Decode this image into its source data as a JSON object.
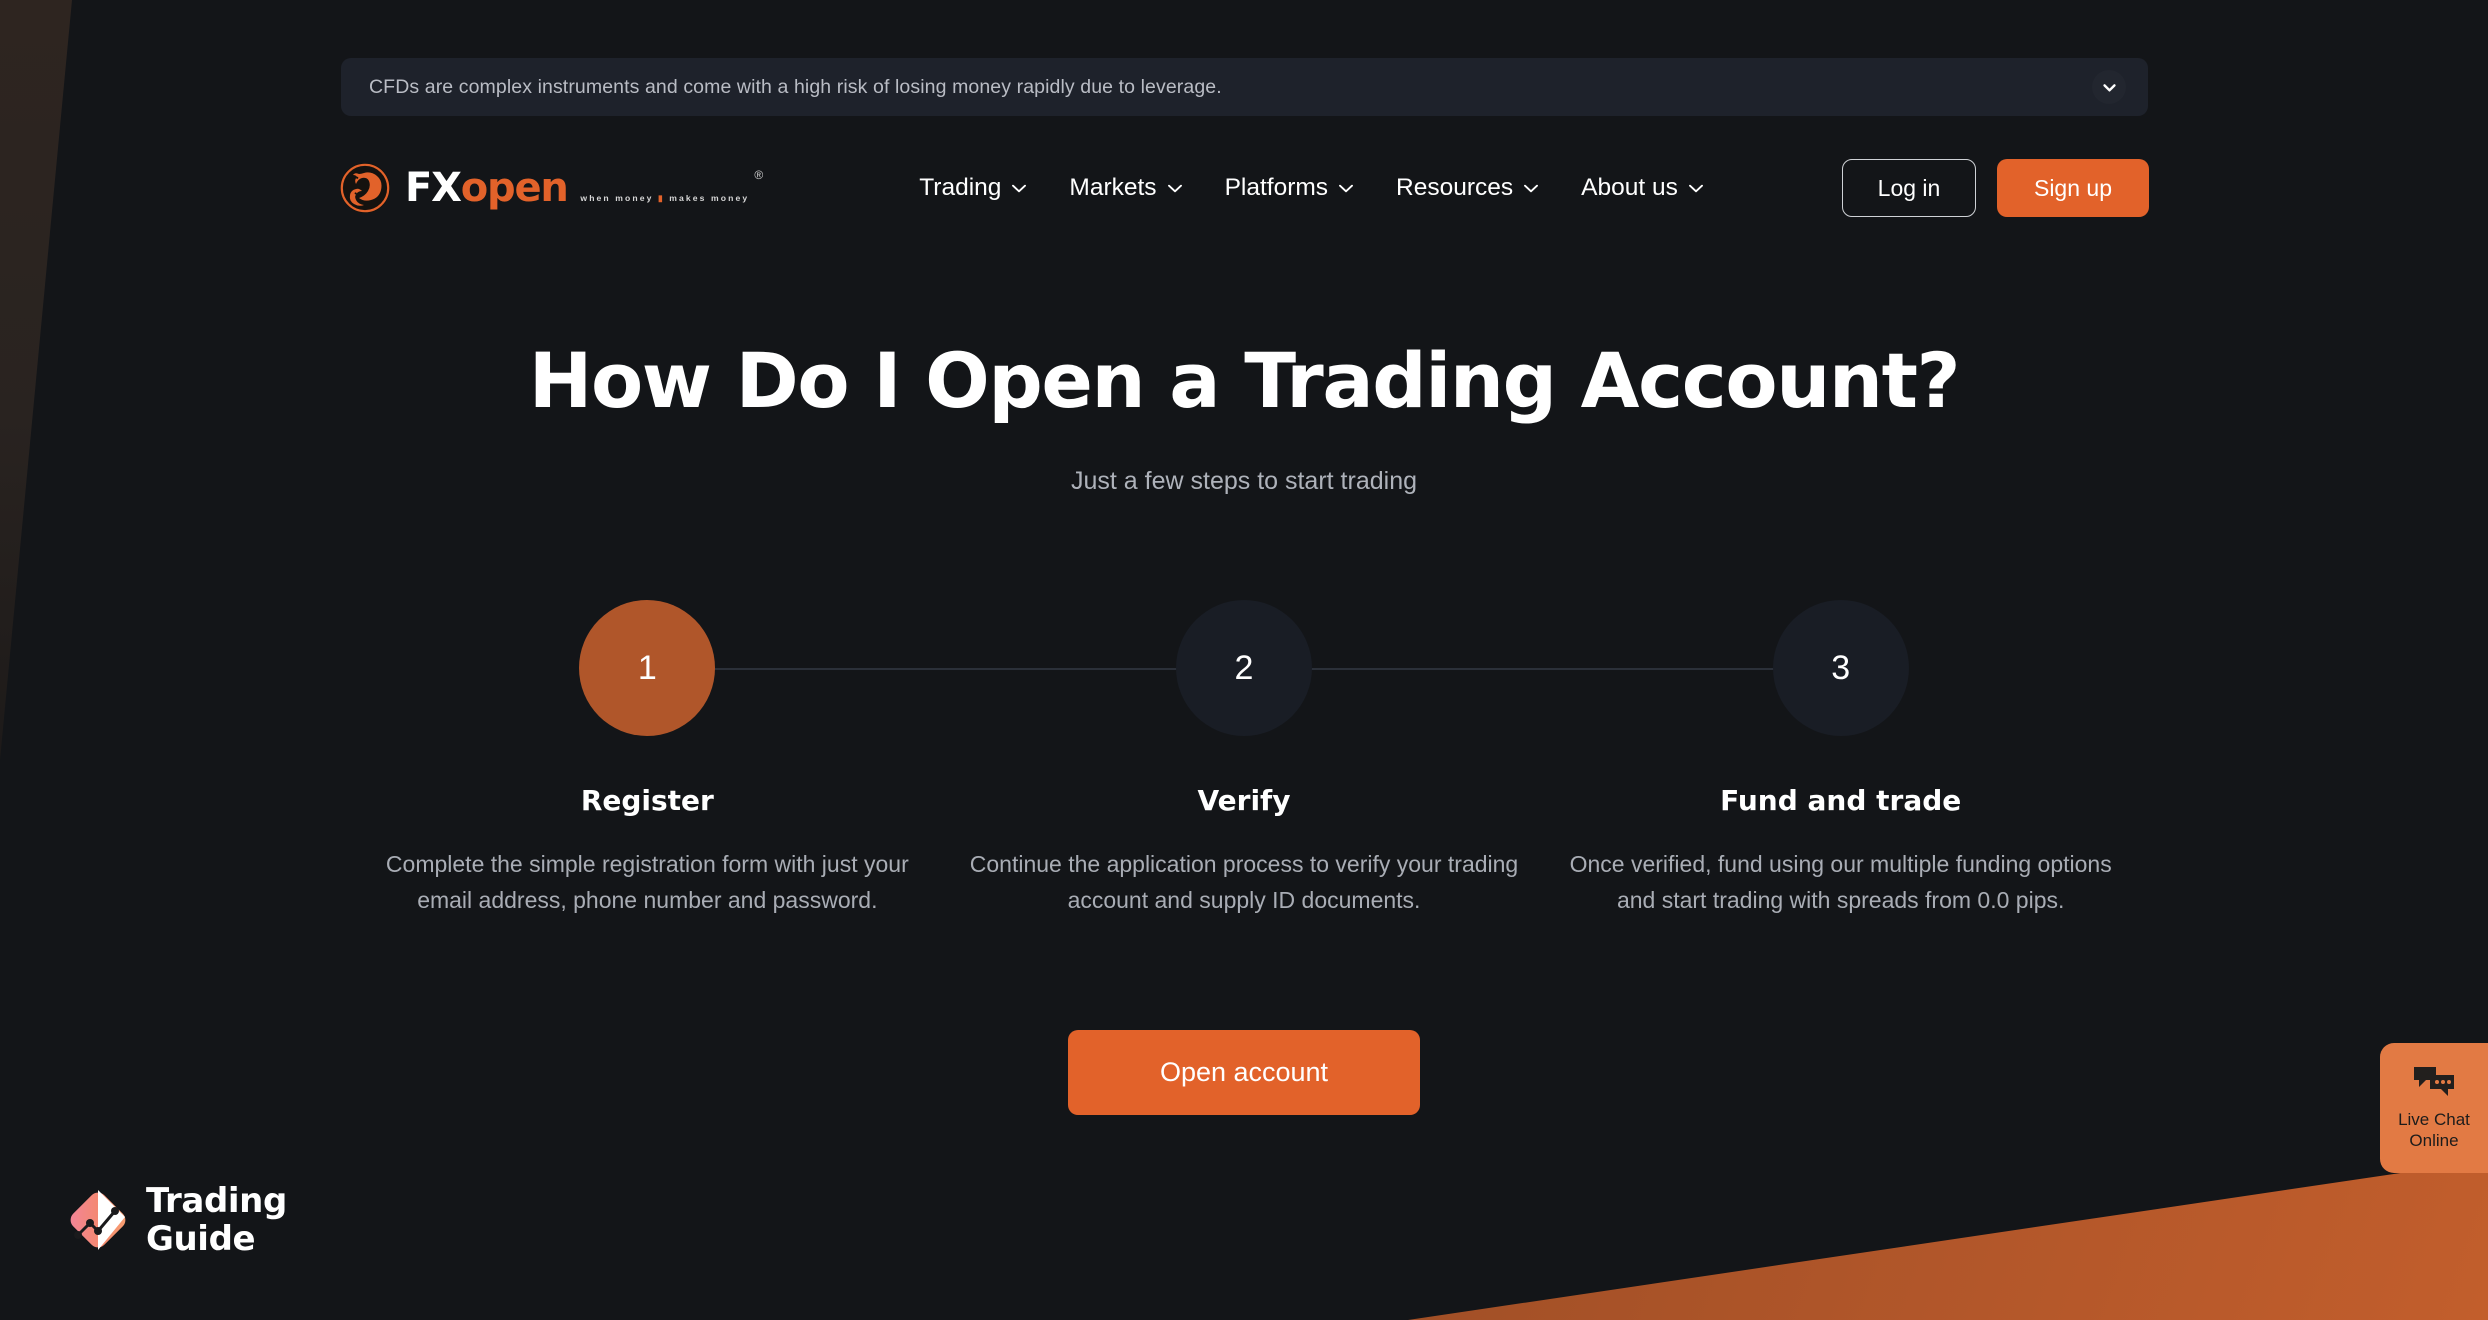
{
  "colors": {
    "page_bg": "#131518",
    "accent_orange": "#e2622a",
    "step_active": "#b0562a",
    "step_inactive": "#191d25",
    "banner_bg": "#1e222b",
    "muted_text": "#a9adb5",
    "live_chat_bg": "#e27a44"
  },
  "disclaimer": {
    "text": "CFDs are complex instruments and come with a high risk of losing money rapidly due to leverage.",
    "toggle_icon": "chevron-down-icon"
  },
  "header": {
    "logo": {
      "mark_icon": "fxopen-bull-bear-emblem",
      "word_first": "FX",
      "word_second": "open",
      "registered_mark": "®",
      "tagline_left": "when money",
      "tagline_right": "makes money"
    },
    "nav": [
      {
        "label": "Trading",
        "icon": "chevron-down-icon"
      },
      {
        "label": "Markets",
        "icon": "chevron-down-icon"
      },
      {
        "label": "Platforms",
        "icon": "chevron-down-icon"
      },
      {
        "label": "Resources",
        "icon": "chevron-down-icon"
      },
      {
        "label": "About us",
        "icon": "chevron-down-icon"
      }
    ],
    "login_label": "Log in",
    "signup_label": "Sign up"
  },
  "hero": {
    "title": "How Do I Open a Trading Account?",
    "subtitle": "Just a few steps to start trading"
  },
  "steps": [
    {
      "number": "1",
      "title": "Register",
      "description": "Complete the simple registration form with just your email address, phone number and password.",
      "active": true
    },
    {
      "number": "2",
      "title": "Verify",
      "description": "Continue the application process to verify your trading account and supply ID documents.",
      "active": false
    },
    {
      "number": "3",
      "title": "Fund and trade",
      "description": "Once verified, fund using our multiple funding options and start trading with spreads from 0.0 pips.",
      "active": false
    }
  ],
  "cta": {
    "label": "Open account"
  },
  "watermark": {
    "mark_icon": "trading-guide-diamond-chart-icon",
    "line1": "Trading",
    "line2": "Guide"
  },
  "live_chat": {
    "icon": "chat-bubbles-icon",
    "line1": "Live Chat",
    "line2": "Online"
  }
}
